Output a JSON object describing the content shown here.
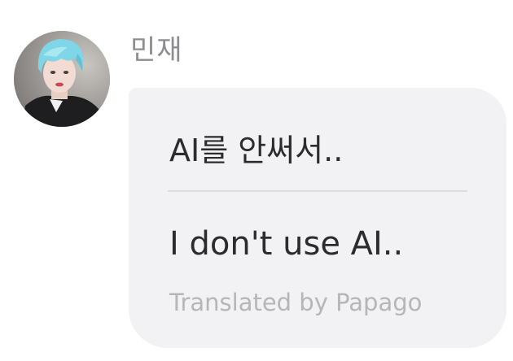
{
  "message": {
    "sender": {
      "name": "민재",
      "avatar_icon": "profile-photo"
    },
    "original_text": "AI를 안써서..",
    "translated_text": "I don't use AI..",
    "translation_credit": "Translated by Papago"
  },
  "colors": {
    "bubble_background": "#f2f2f4",
    "divider": "#dedee2",
    "message_text": "#2c2c2e",
    "sender_name": "#8d8d92",
    "credit_text": "#b5b5ba",
    "avatar_hair": "#7fd6e6"
  }
}
